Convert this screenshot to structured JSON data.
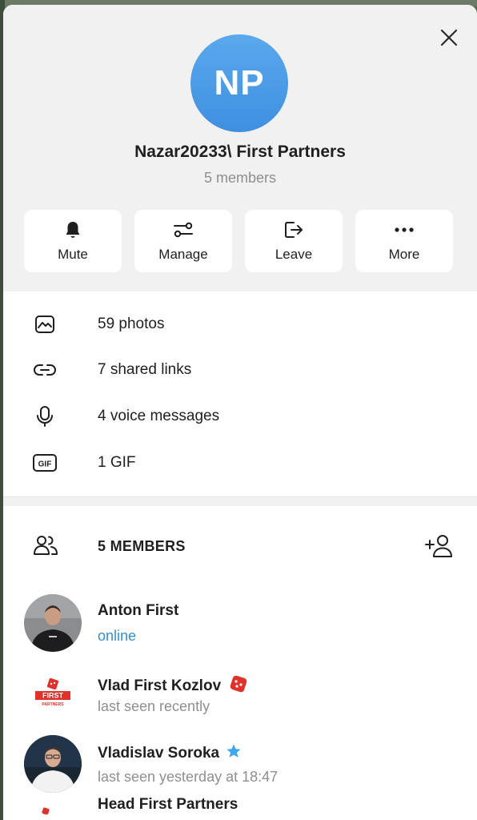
{
  "header": {
    "avatar_initials": "NP",
    "title": "Nazar20233\\ First Partners",
    "subtitle": "5 members",
    "close_icon": "close-icon"
  },
  "actions": [
    {
      "label": "Mute",
      "icon": "bell-icon"
    },
    {
      "label": "Manage",
      "icon": "sliders-icon"
    },
    {
      "label": "Leave",
      "icon": "leave-icon"
    },
    {
      "label": "More",
      "icon": "more-dots-icon"
    }
  ],
  "media": [
    {
      "label": "59 photos",
      "icon": "photo-icon"
    },
    {
      "label": "7 shared links",
      "icon": "link-icon"
    },
    {
      "label": "4 voice messages",
      "icon": "microphone-icon"
    },
    {
      "label": "1 GIF",
      "icon": "gif-icon"
    }
  ],
  "members": {
    "title": "5 MEMBERS",
    "list": [
      {
        "name": "Anton First",
        "status": "online"
      },
      {
        "name": "Vlad First Kozlov",
        "status": "last seen recently"
      },
      {
        "name": "Vladislav Soroka",
        "status": "last seen yesterday at 18:47"
      },
      {
        "name": "Head First Partners",
        "status": ""
      }
    ],
    "logo_text": "FIRST",
    "logo_sub": "PARTNERS"
  },
  "colors": {
    "accent": "#3e8fe0",
    "online": "#2f8fd8",
    "muted": "#8e8e93",
    "header_bg": "#f1f1f1",
    "badge_red": "#e0312b",
    "star_blue": "#3ea6f0"
  }
}
